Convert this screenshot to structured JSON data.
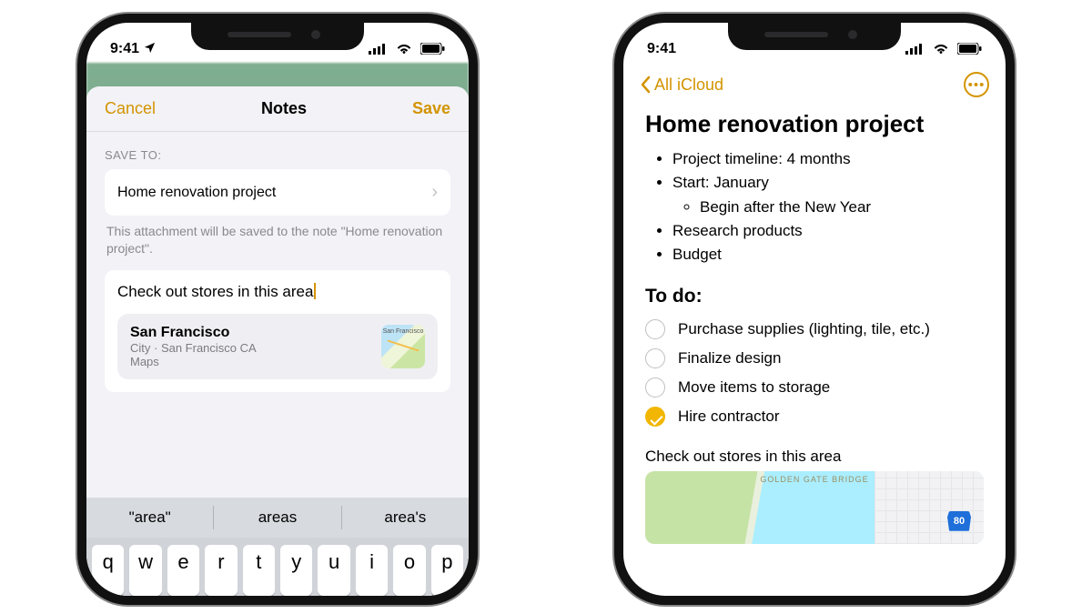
{
  "status": {
    "time": "9:41"
  },
  "phone1": {
    "header": {
      "cancel": "Cancel",
      "title": "Notes",
      "save": "Save"
    },
    "saveto_label": "SAVE TO:",
    "destination": "Home renovation project",
    "helptext": "This attachment will be saved to the note \"Home renovation project\".",
    "note_input": "Check out stores in this area",
    "attachment": {
      "title": "San Francisco",
      "subtitle": "City · San Francisco CA",
      "source": "Maps",
      "thumb_label": "San Francisco"
    },
    "suggestions": [
      "\"area\"",
      "areas",
      "area's"
    ],
    "keys": [
      "q",
      "w",
      "e",
      "r",
      "t",
      "y",
      "u",
      "i",
      "o",
      "p"
    ]
  },
  "phone2": {
    "back_label": "All iCloud",
    "title": "Home renovation project",
    "bullets": [
      "Project timeline: 4 months",
      "Start: January",
      "Research products",
      "Budget"
    ],
    "sub_bullet": "Begin after the New Year",
    "todo_heading": "To do:",
    "todos": [
      {
        "label": "Purchase supplies (lighting, tile, etc.)",
        "done": false
      },
      {
        "label": "Finalize design",
        "done": false
      },
      {
        "label": "Move items to storage",
        "done": false
      },
      {
        "label": "Hire contractor",
        "done": true
      }
    ],
    "subtext": "Check out stores in this area",
    "map": {
      "label": "GOLDEN GATE BRIDGE",
      "shield": "80"
    }
  }
}
